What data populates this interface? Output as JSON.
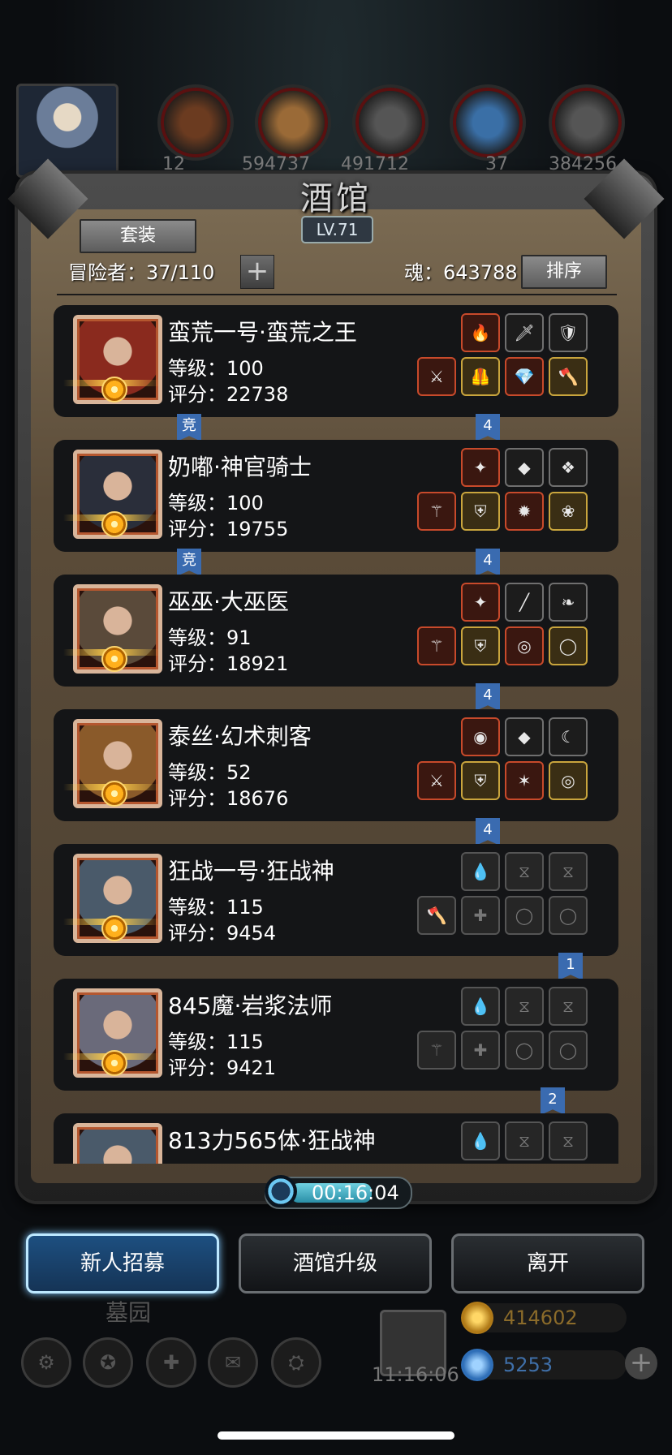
{
  "top": {
    "resource_numbers": [
      "12",
      "594737",
      "491712",
      "",
      "37",
      "384256"
    ]
  },
  "header": {
    "title": "酒馆",
    "level": "LV.71",
    "set_button": "套装",
    "adventurers": "冒险者：37/110",
    "add_button": "+",
    "souls": "魂：643788",
    "sort_button": "排序"
  },
  "heroes": [
    {
      "name": "蛮荒一号·蛮荒之王",
      "level": "等级：100",
      "score": "评分：22738",
      "tag_left": "竞",
      "tag_right": "4",
      "top_slots": [
        "🔥",
        "🗡",
        "🛡"
      ],
      "bottom_slots": [
        "⚔",
        "🦺",
        "💎",
        "🪓"
      ],
      "style": "filled"
    },
    {
      "name": "奶嘟·神官骑士",
      "level": "等级：100",
      "score": "评分：19755",
      "tag_left": "竞",
      "tag_right": "4",
      "top_slots": [
        "✦",
        "◆",
        "❖"
      ],
      "bottom_slots": [
        "⚚",
        "⛨",
        "✹",
        "❀"
      ],
      "style": "filled"
    },
    {
      "name": "巫巫·大巫医",
      "level": "等级：91",
      "score": "评分：18921",
      "tag_left": "",
      "tag_right": "4",
      "top_slots": [
        "✦",
        "╱",
        "❧"
      ],
      "bottom_slots": [
        "⚚",
        "⛨",
        "◎",
        "◯"
      ],
      "style": "filled"
    },
    {
      "name": "泰丝·幻术刺客",
      "level": "等级：52",
      "score": "评分：18676",
      "tag_left": "",
      "tag_right": "4",
      "top_slots": [
        "◉",
        "◆",
        "☾"
      ],
      "bottom_slots": [
        "⚔",
        "⛨",
        "✶",
        "◎"
      ],
      "style": "filled"
    },
    {
      "name": "狂战一号·狂战神",
      "level": "等级：115",
      "score": "评分：9454",
      "tag_left": "",
      "tag_right": "1",
      "top_slots": [
        "💧",
        "⧖",
        "⧖"
      ],
      "bottom_slots": [
        "🪓",
        "✚",
        "◯",
        "◯"
      ],
      "style": "empty"
    },
    {
      "name": "845魔·岩浆法师",
      "level": "等级：115",
      "score": "评分：9421",
      "tag_left": "",
      "tag_right": "2",
      "top_slots": [
        "💧",
        "⧖",
        "⧖"
      ],
      "bottom_slots": [
        "⚚",
        "✚",
        "◯",
        "◯"
      ],
      "style": "empty"
    },
    {
      "name": "813力565体·狂战神",
      "level": "",
      "score": "",
      "tag_left": "",
      "tag_right": "",
      "top_slots": [
        "💧",
        "⧖",
        "⧖"
      ],
      "bottom_slots": [],
      "style": "empty"
    }
  ],
  "timer": {
    "text": "00:16:04"
  },
  "actions": {
    "recruit": "新人招募",
    "upgrade": "酒馆升级",
    "leave": "离开"
  },
  "bottom": {
    "graveyard": "墓园",
    "time": "11:16:06",
    "gold": "414602",
    "gems": "5253"
  },
  "colors": {
    "accent_blue": "#3a6bb0",
    "gold": "#c9a53d",
    "gem_blue": "#4f8fe6"
  }
}
